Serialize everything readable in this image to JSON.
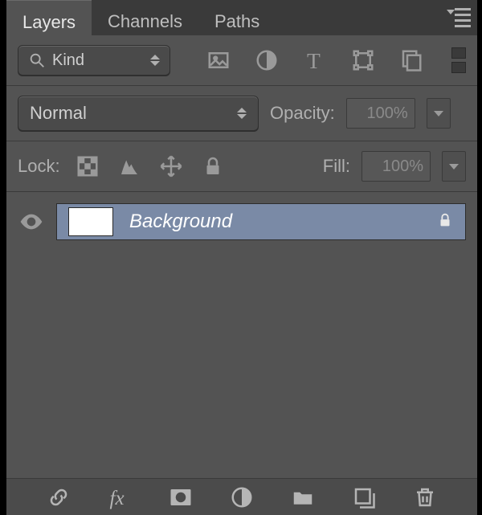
{
  "tabs": {
    "layers": "Layers",
    "channels": "Channels",
    "paths": "Paths",
    "active": "layers"
  },
  "filter": {
    "mode": "Kind"
  },
  "blend": {
    "mode": "Normal",
    "opacity_label": "Opacity:",
    "opacity_value": "100%"
  },
  "lock": {
    "label": "Lock:",
    "fill_label": "Fill:",
    "fill_value": "100%"
  },
  "layers": [
    {
      "name": "Background",
      "visible": true,
      "locked": true,
      "selected": true
    }
  ]
}
